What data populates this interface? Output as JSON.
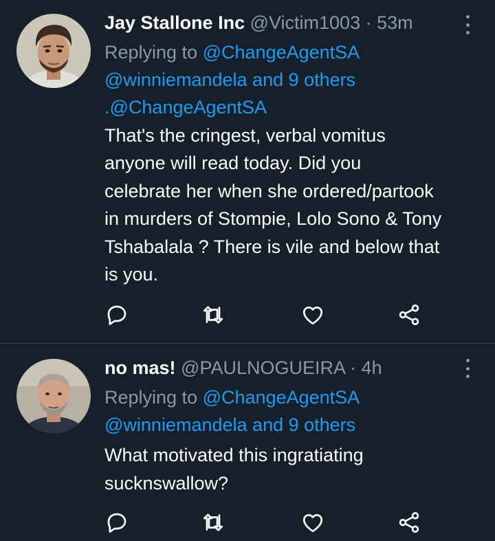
{
  "tweets": [
    {
      "display_name": "Jay Stallone Inc",
      "handle": "@Victim1003",
      "separator": "·",
      "time": "53m",
      "replying_prefix": "Replying to",
      "replying_to": "@ChangeAgentSA",
      "replying_others_handle": "@winniemandela",
      "replying_others_suffix": "and 9 others",
      "mention": ".@ChangeAgentSA",
      "body_lines": [
        "That's the cringest, verbal vomitus",
        "anyone will read today. Did you",
        "celebrate her when she ordered/partook",
        "in murders of Stompie, Lolo Sono & Tony",
        "Tshabalala ? There is vile and below that",
        "is you."
      ]
    },
    {
      "display_name": "no mas!",
      "handle": "@PAULNOGUEIRA",
      "separator": "·",
      "time": "4h",
      "replying_prefix": "Replying to",
      "replying_to": "@ChangeAgentSA",
      "replying_others_handle": "@winniemandela",
      "replying_others_suffix": "and 9 others",
      "body_lines": [
        "What motivated this ingratiating",
        "sucknswallow?"
      ]
    }
  ],
  "icons": [
    "reply-icon",
    "retweet-icon",
    "like-icon",
    "share-icon",
    "more-icon"
  ],
  "colors": {
    "background": "#15202b",
    "text": "#ffffff",
    "secondary_text": "#8b98a5",
    "link": "#1d9bf0",
    "divider": "#38444d"
  }
}
